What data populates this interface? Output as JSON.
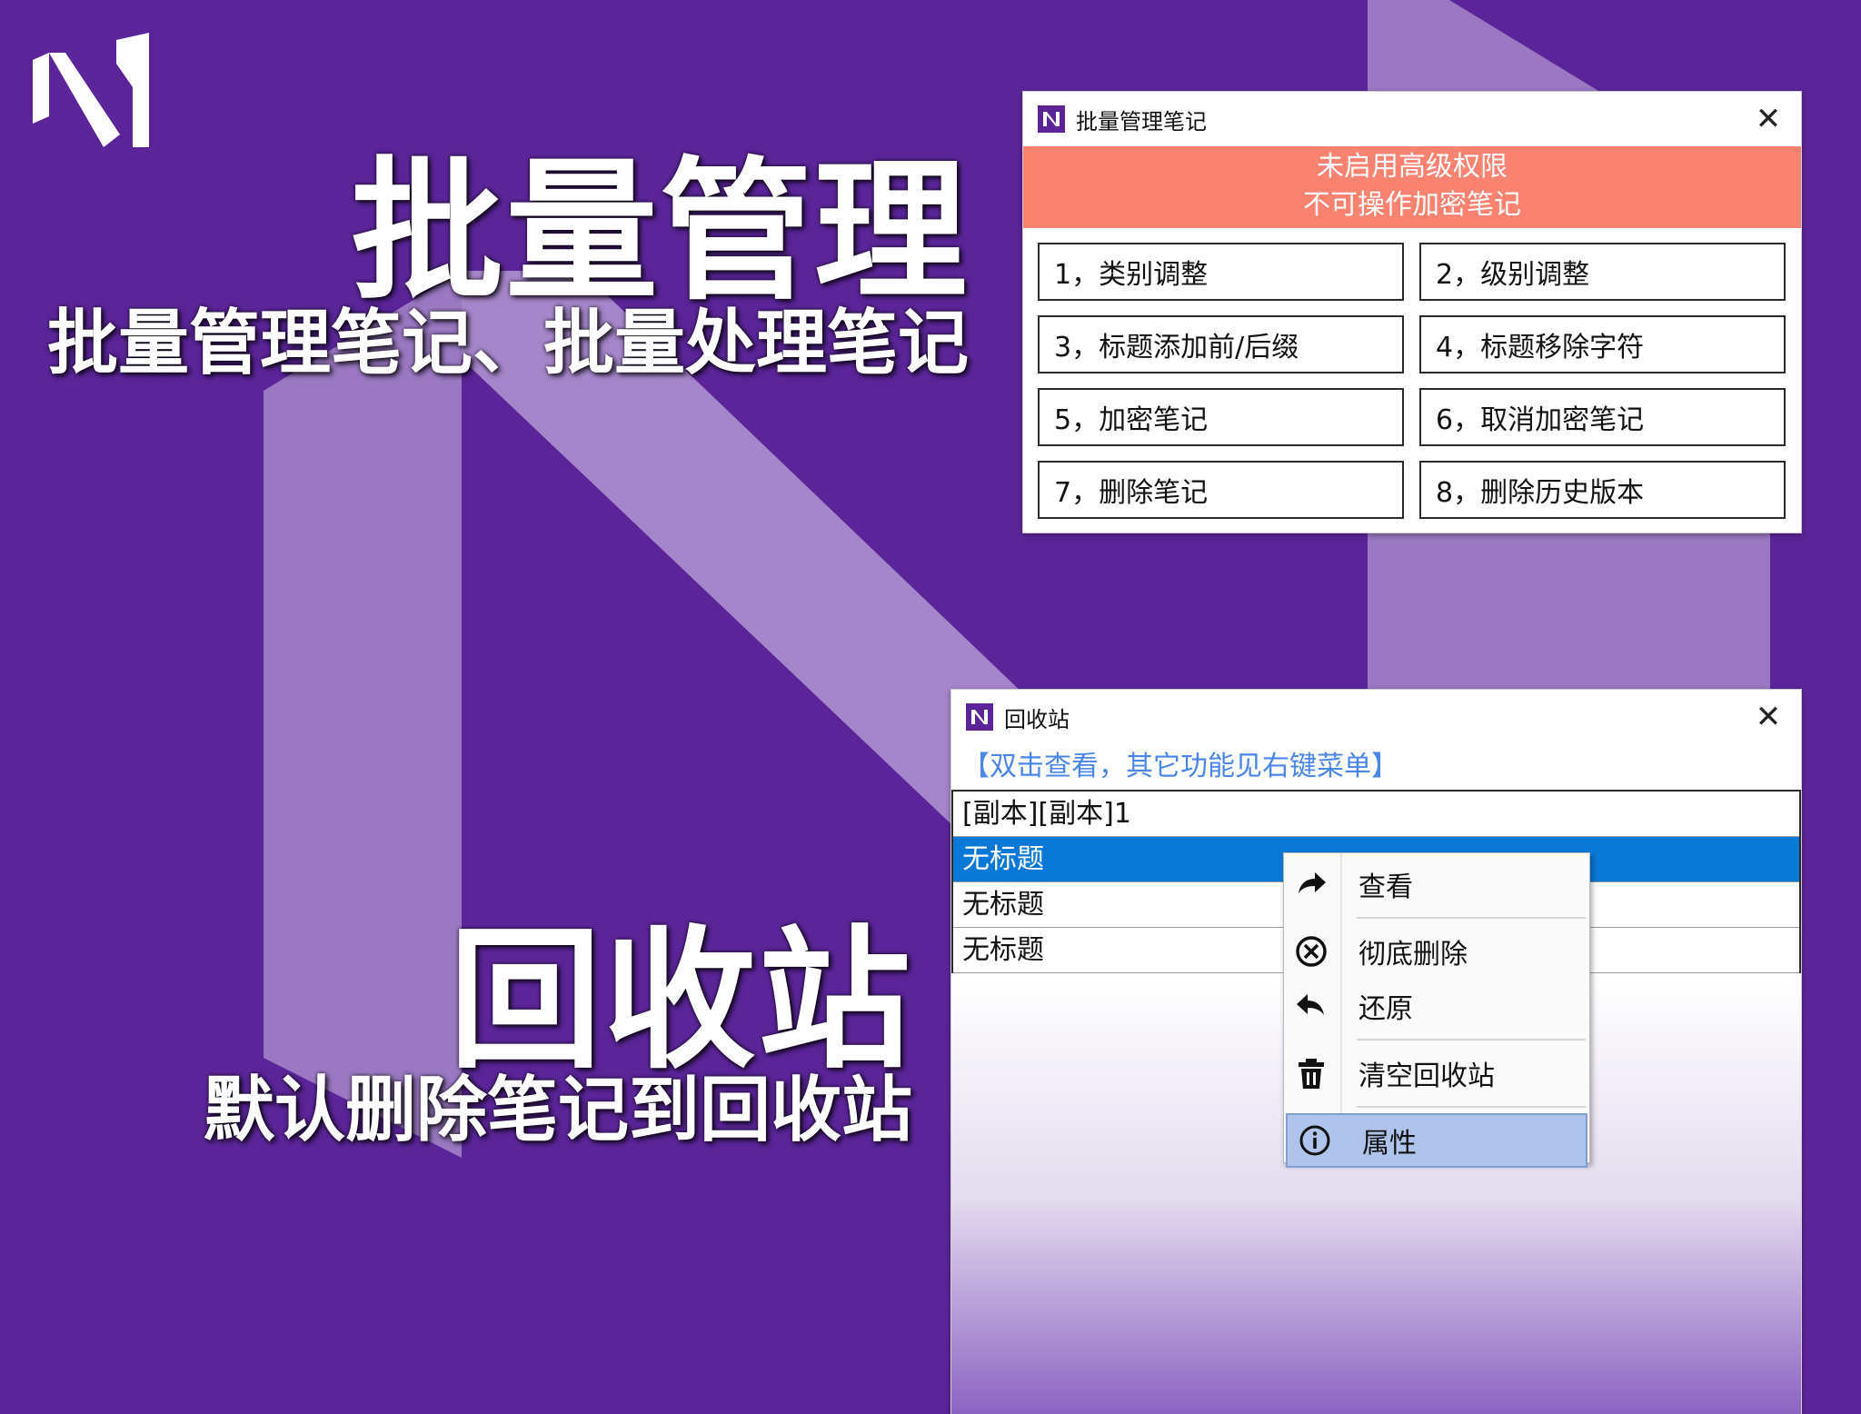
{
  "hero": {
    "title_1": "批量管理",
    "subtitle_1": "批量管理笔记、批量处理笔记",
    "title_2": "回收站",
    "subtitle_2": "默认删除笔记到回收站"
  },
  "colors": {
    "background": "#5b2599",
    "band": "#a07fc6",
    "warning": "#f98271",
    "selection": "#0a78d7",
    "hint": "#4a86e8",
    "menu_hover": "#aec4ea"
  },
  "batch_dialog": {
    "title": "批量管理笔记",
    "close": "✕",
    "warning_line1": "未启用高级权限",
    "warning_line2": "不可操作加密笔记",
    "buttons": [
      "1，类别调整",
      "2，级别调整",
      "3，标题添加前/后缀",
      "4，标题移除字符",
      "5，加密笔记",
      "6，取消加密笔记",
      "7，删除笔记",
      "8，删除历史版本"
    ]
  },
  "recycle_dialog": {
    "title": "回收站",
    "close": "✕",
    "hint": "【双击查看，其它功能见右键菜单】",
    "items": [
      "[副本][副本]1",
      "无标题",
      "无标题",
      "无标题"
    ],
    "selected_index": 1
  },
  "context_menu": {
    "items": [
      {
        "label": "查看",
        "icon": "forward-arrow-icon"
      },
      {
        "label": "彻底删除",
        "icon": "circle-x-icon"
      },
      {
        "label": "还原",
        "icon": "back-arrow-icon"
      },
      {
        "label": "清空回收站",
        "icon": "trash-icon"
      },
      {
        "label": "属性",
        "icon": "info-icon"
      }
    ]
  }
}
